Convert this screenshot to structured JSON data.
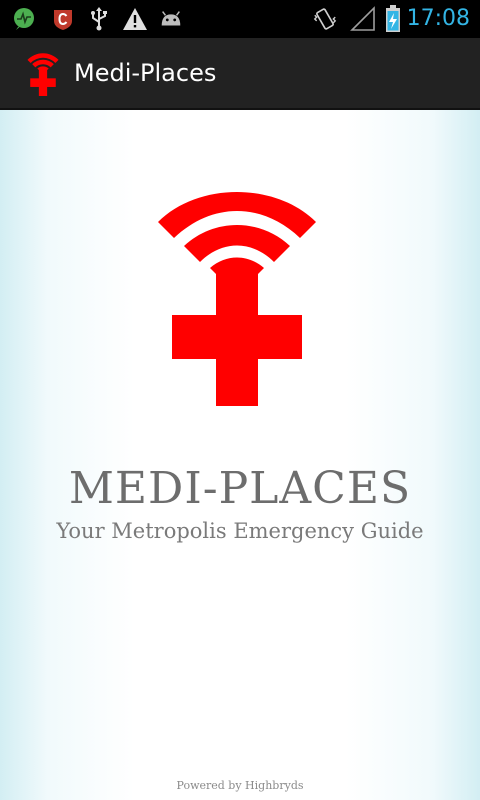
{
  "status_bar": {
    "time": "17:08",
    "icons": [
      "activity-icon",
      "shield-c-icon",
      "usb-icon",
      "warning-icon",
      "android-icon",
      "vibrate-icon",
      "signal-icon",
      "battery-charging-icon"
    ],
    "accent_color": "#33b5e5"
  },
  "action_bar": {
    "app_icon": "medi-places-logo-icon",
    "title": "Medi-Places"
  },
  "splash": {
    "logo_icon": "wifi-cross-logo-icon",
    "brand_color": "#ff0000",
    "title": "MEDI-PLACES",
    "subtitle": "Your Metropolis Emergency Guide",
    "footer": "Powered by Highbryds"
  }
}
